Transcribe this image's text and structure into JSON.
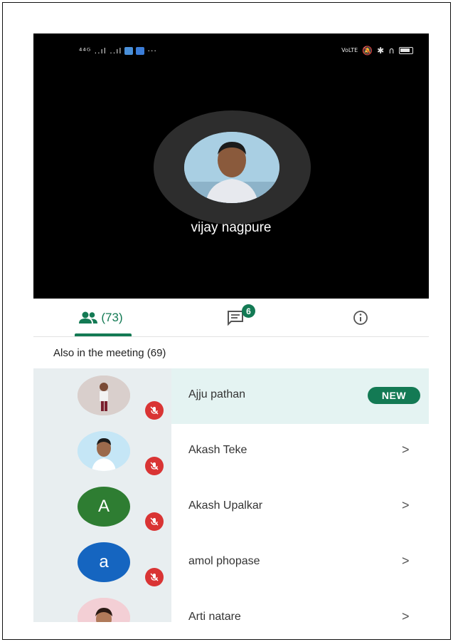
{
  "status_bar": {
    "left_text": "⁴⁴ᴳ ..ıl ..ıl",
    "right_text": "VoLTE"
  },
  "presenter": {
    "name": "vijay nagpure"
  },
  "tabs": {
    "people_count": "(73)",
    "chat_badge": "6"
  },
  "section": {
    "title": "Also in the meeting (69)"
  },
  "participants": [
    {
      "name": "Ajju pathan",
      "avatar_letter": "",
      "avatar_type": "photo",
      "tag": "NEW",
      "muted": true
    },
    {
      "name": "Akash Teke",
      "avatar_letter": "",
      "avatar_type": "photo",
      "tag": "",
      "muted": true
    },
    {
      "name": "Akash Upalkar",
      "avatar_letter": "A",
      "avatar_type": "letter",
      "avatar_color": "#2e7d32",
      "tag": "",
      "muted": true
    },
    {
      "name": "amol phopase",
      "avatar_letter": "a",
      "avatar_type": "letter",
      "avatar_color": "#1565c0",
      "tag": "",
      "muted": true
    },
    {
      "name": "Arti natare",
      "avatar_letter": "",
      "avatar_type": "photo",
      "tag": "",
      "muted": false
    }
  ],
  "colors": {
    "accent": "#137a54",
    "mute": "#d93434",
    "highlight": "#e4f3f2"
  }
}
